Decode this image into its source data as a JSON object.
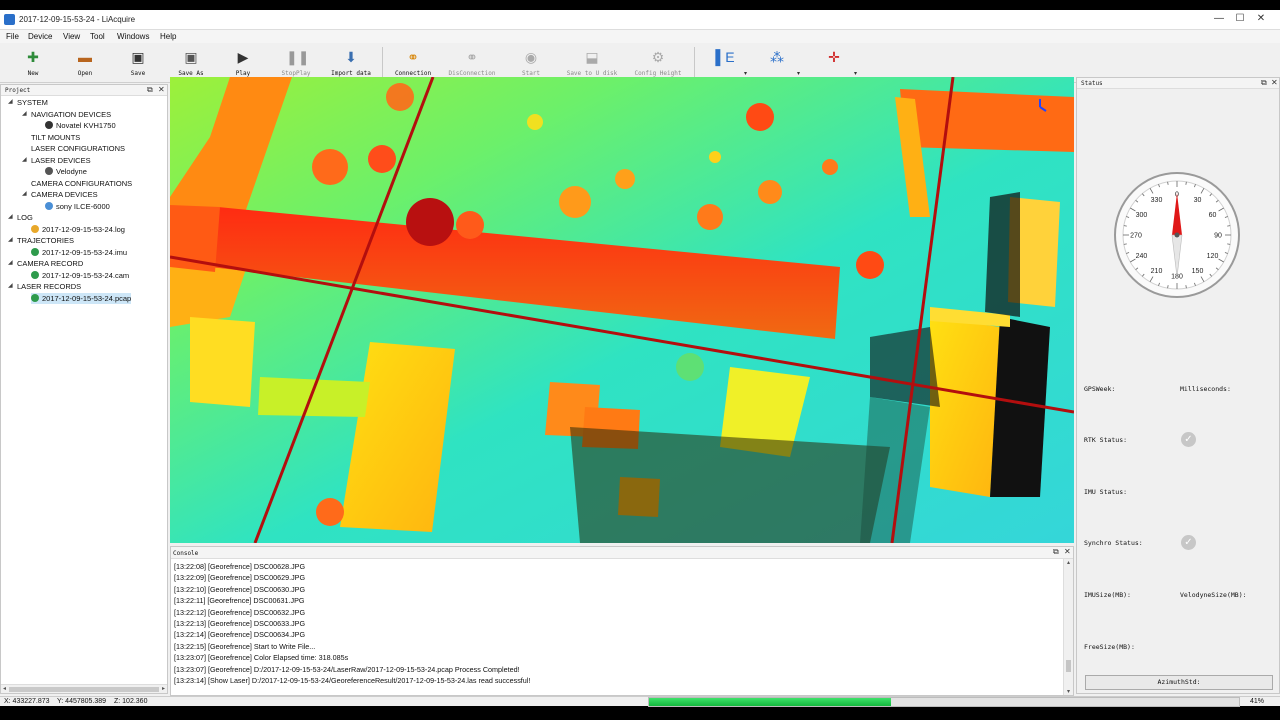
{
  "window": {
    "title": "2017-12-09-15-53-24 - LiAcquire",
    "controls": {
      "minimize": "—",
      "maximize": "☐",
      "close": "✕"
    }
  },
  "menu": [
    "File",
    "Device",
    "View",
    "Tool",
    "Windows",
    "Help"
  ],
  "toolbar": [
    {
      "label": "New",
      "icon": "new-file-icon",
      "glyph": "✚",
      "color": "#2e8b3a",
      "enabled": true
    },
    {
      "label": "Open",
      "icon": "open-folder-icon",
      "glyph": "▬",
      "color": "#b8651e",
      "enabled": true
    },
    {
      "label": "Save",
      "icon": "floppy-disk-icon",
      "glyph": "▣",
      "color": "#333333",
      "enabled": true
    },
    {
      "label": "Save As",
      "icon": "save-as-icon",
      "glyph": "▣",
      "color": "#555555",
      "enabled": true
    },
    {
      "label": "Play",
      "icon": "play-icon",
      "glyph": "▶",
      "color": "#333333",
      "enabled": true
    },
    {
      "label": "StopPlay",
      "icon": "pause-icon",
      "glyph": "❚❚",
      "color": "#999999",
      "enabled": false
    },
    {
      "label": "Import data",
      "icon": "import-data-icon",
      "glyph": "⬇",
      "color": "#3a6fb0",
      "enabled": true
    },
    {
      "label": "Connection",
      "icon": "plug-connect-icon",
      "glyph": "⚭",
      "color": "#d88a12",
      "enabled": true
    },
    {
      "label": "DisConnection",
      "icon": "plug-disconnect-icon",
      "glyph": "⚭",
      "color": "#aaaaaa",
      "enabled": false
    },
    {
      "label": "Start",
      "icon": "start-icon",
      "glyph": "◉",
      "color": "#aaaaaa",
      "enabled": false
    },
    {
      "label": "Save to U disk",
      "icon": "usb-disk-icon",
      "glyph": "⬓",
      "color": "#aaaaaa",
      "enabled": false
    },
    {
      "label": "Config Height",
      "icon": "gear-icon",
      "glyph": "⚙",
      "color": "#aaaaaa",
      "enabled": false
    }
  ],
  "toolbar_extra": [
    {
      "icon": "elevation-color-icon",
      "glyph": "▌E",
      "color": "#2a6fc9"
    },
    {
      "icon": "point-cloud-icon",
      "glyph": "⁂",
      "color": "#2a6fc9"
    },
    {
      "icon": "crosshair-icon",
      "glyph": "✛",
      "color": "#cc1111"
    }
  ],
  "project": {
    "title": "Project",
    "tree": [
      {
        "label": "SYSTEM",
        "level": 0,
        "toggle": "◢"
      },
      {
        "label": "NAVIGATION DEVICES",
        "level": 1,
        "toggle": "◢"
      },
      {
        "label": "Novatel KVH1750",
        "level": 2,
        "icon": "nav-device-icon",
        "iconColor": "#333333"
      },
      {
        "label": "TILT MOUNTS",
        "level": 1
      },
      {
        "label": "LASER CONFIGURATIONS",
        "level": 1
      },
      {
        "label": "LASER DEVICES",
        "level": 1,
        "toggle": "◢"
      },
      {
        "label": "Velodyne",
        "level": 2,
        "icon": "laser-device-icon",
        "iconColor": "#555555"
      },
      {
        "label": "CAMERA CONFIGURATIONS",
        "level": 1
      },
      {
        "label": "CAMERA DEVICES",
        "level": 1,
        "toggle": "◢"
      },
      {
        "label": "sony ILCE-6000",
        "level": 2,
        "icon": "camera-device-icon",
        "iconColor": "#4a8fd6"
      },
      {
        "label": "LOG",
        "level": 0,
        "toggle": "◢"
      },
      {
        "label": "2017-12-09-15-53-24.log",
        "level": 1,
        "icon": "log-file-icon",
        "iconColor": "#e8a82a"
      },
      {
        "label": "TRAJECTORIES",
        "level": 0,
        "toggle": "◢"
      },
      {
        "label": "2017-12-09-15-53-24.imu",
        "level": 1,
        "icon": "imu-file-icon",
        "iconColor": "#2e9b4c"
      },
      {
        "label": "CAMERA RECORD",
        "level": 0,
        "toggle": "◢"
      },
      {
        "label": "2017-12-09-15-53-24.cam",
        "level": 1,
        "icon": "cam-file-icon",
        "iconColor": "#2e9b4c"
      },
      {
        "label": "LASER RECORDS",
        "level": 0,
        "toggle": "◢"
      },
      {
        "label": "2017-12-09-15-53-24.pcap",
        "level": 1,
        "icon": "pcap-file-icon",
        "iconColor": "#2e9b4c",
        "selected": true
      }
    ]
  },
  "console": {
    "title": "Console",
    "lines": [
      "[13:22:08] [Georefrence]  DSC00628.JPG",
      "[13:22:09] [Georefrence]  DSC00629.JPG",
      "[13:22:10] [Georefrence]  DSC00630.JPG",
      "[13:22:11] [Georefrence]  DSC00631.JPG",
      "[13:22:12] [Georefrence]  DSC00632.JPG",
      "[13:22:13] [Georefrence]  DSC00633.JPG",
      "[13:22:14] [Georefrence]  DSC00634.JPG",
      "[13:22:15] [Georefrence]  Start to Write File...",
      "[13:23:07] [Georefrence]  Color Elapsed time: 318.085s",
      "[13:23:07] [Georefrence]  D:/2017-12-09-15-53-24/LaserRaw/2017-12-09-15-53-24.pcap Process Completed!",
      "[13:23:14] [Show Laser]  D:/2017-12-09-15-53-24/GeoreferenceResult/2017-12-09-15-53-24.las read successful!"
    ]
  },
  "status": {
    "title": "Status",
    "compass": {
      "heading_deg": 0,
      "labels": [
        "0",
        "30",
        "60",
        "90",
        "120",
        "150",
        "180",
        "210",
        "240",
        "270",
        "300",
        "330"
      ]
    },
    "fields": {
      "gps_week": "GPSWeek:",
      "milliseconds": "Milliseconds:",
      "rtk_status": "RTK Status:",
      "imu_status": "IMU Status:",
      "synchro_status": "Synchro Status:",
      "imu_size": "IMUSize(MB):",
      "velodyne_size": "VelodyneSize(MB):",
      "free_size": "FreeSize(MB):"
    },
    "rtk_ok": true,
    "synchro_ok": true,
    "azimuth_button": "AzimuthStd:"
  },
  "statusbar": {
    "x": "X: 433227.873",
    "y": "Y: 4457805.389",
    "z": "Z: 102.360",
    "progress": 0.41,
    "progress_label": "41%"
  }
}
